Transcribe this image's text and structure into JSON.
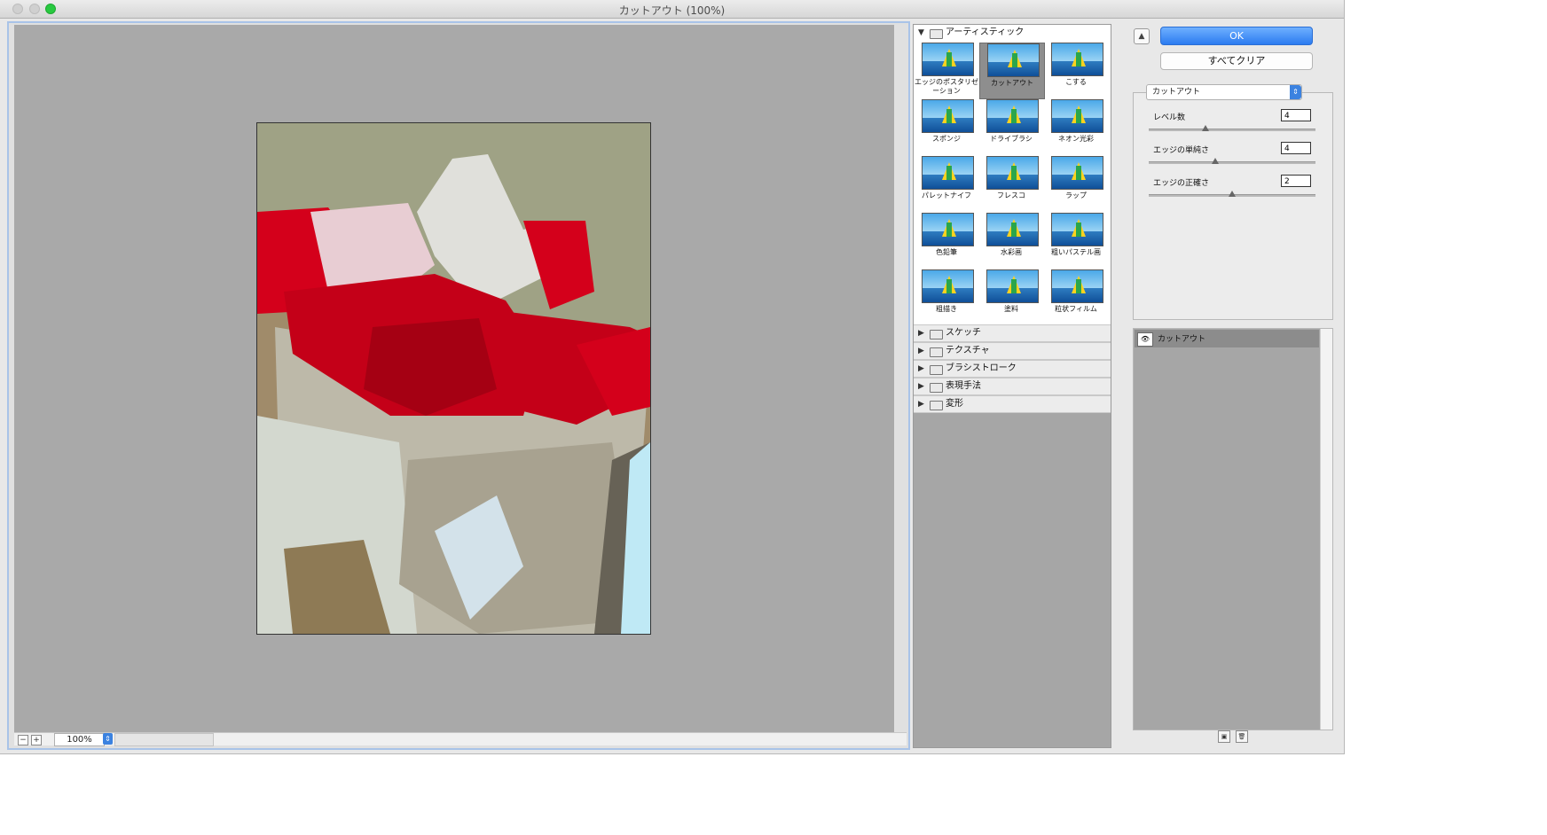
{
  "window": {
    "title": "カットアウト (100%)"
  },
  "preview": {
    "zoom": "100%",
    "minus": "−",
    "plus": "+"
  },
  "gallery": {
    "open_category": "アーティスティック",
    "filters": [
      {
        "label": "エッジのポスタリゼーション",
        "selected": false
      },
      {
        "label": "カットアウト",
        "selected": true
      },
      {
        "label": "こする",
        "selected": false
      },
      {
        "label": "スポンジ",
        "selected": false
      },
      {
        "label": "ドライブラシ",
        "selected": false
      },
      {
        "label": "ネオン光彩",
        "selected": false
      },
      {
        "label": "パレットナイフ",
        "selected": false
      },
      {
        "label": "フレスコ",
        "selected": false
      },
      {
        "label": "ラップ",
        "selected": false
      },
      {
        "label": "色鉛筆",
        "selected": false
      },
      {
        "label": "水彩画",
        "selected": false
      },
      {
        "label": "粗いパステル画",
        "selected": false
      },
      {
        "label": "粗描き",
        "selected": false
      },
      {
        "label": "塗料",
        "selected": false
      },
      {
        "label": "粒状フィルム",
        "selected": false
      }
    ],
    "closed_categories": [
      "スケッチ",
      "テクスチャ",
      "ブラシストローク",
      "表現手法",
      "変形"
    ]
  },
  "controls": {
    "ok": "OK",
    "clear_all": "すべてクリア",
    "filter_select": "カットアウト",
    "params": [
      {
        "label": "レベル数",
        "value": "4",
        "fraction": 0.34
      },
      {
        "label": "エッジの単純さ",
        "value": "4",
        "fraction": 0.4
      },
      {
        "label": "エッジの正確さ",
        "value": "2",
        "fraction": 0.5
      }
    ]
  },
  "layers": {
    "items": [
      {
        "name": "カットアウト"
      }
    ]
  },
  "colors": {
    "accent": "#2b7bf0",
    "canvas_bg": "#a9a9a9",
    "traffic_green": "#28c940"
  }
}
